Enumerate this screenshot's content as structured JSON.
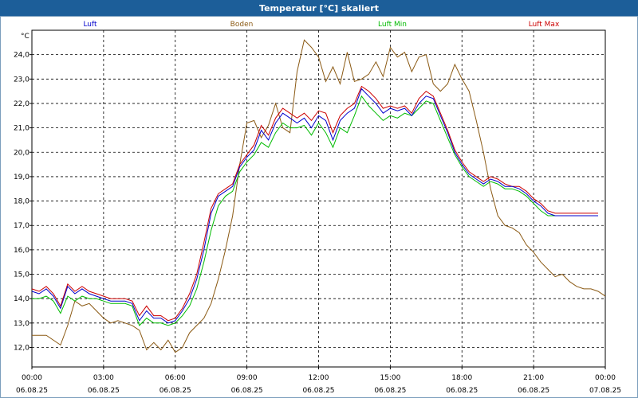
{
  "window": {
    "title": "Temperatur [°C] skaliert"
  },
  "chart_data": {
    "type": "line",
    "title": "Temperatur [°C] skaliert",
    "ylabel": "°C",
    "ylim": [
      11.2,
      25.0
    ],
    "grid": true,
    "x_tick_labels": [
      [
        "00:00",
        "06.08.25"
      ],
      [
        "03:00",
        "06.08.25"
      ],
      [
        "06:00",
        "06.08.25"
      ],
      [
        "09:00",
        "06.08.25"
      ],
      [
        "12:00",
        "06.08.25"
      ],
      [
        "15:00",
        "06.08.25"
      ],
      [
        "18:00",
        "06.08.25"
      ],
      [
        "21:00",
        "06.08.25"
      ],
      [
        "00:00",
        "07.08.25"
      ]
    ],
    "y_ticks": [
      "12,0",
      "13,0",
      "14,0",
      "15,0",
      "16,0",
      "17,0",
      "18,0",
      "19,0",
      "20,0",
      "21,0",
      "22,0",
      "23,0",
      "24,0"
    ],
    "series": [
      {
        "name": "Luft",
        "color": "#0000cc",
        "x": [
          0,
          0.3,
          0.6,
          0.9,
          1.2,
          1.5,
          1.8,
          2.1,
          2.4,
          2.7,
          3,
          3.3,
          3.6,
          3.9,
          4.2,
          4.5,
          4.8,
          5.1,
          5.4,
          5.7,
          6,
          6.3,
          6.6,
          6.9,
          7.2,
          7.5,
          7.8,
          8.1,
          8.4,
          8.7,
          9,
          9.3,
          9.6,
          9.9,
          10.2,
          10.5,
          10.8,
          11.1,
          11.4,
          11.7,
          12,
          12.3,
          12.6,
          12.9,
          13.2,
          13.5,
          13.8,
          14.1,
          14.4,
          14.7,
          15,
          15.3,
          15.6,
          15.9,
          16.2,
          16.5,
          16.8,
          17.1,
          17.4,
          17.7,
          18,
          18.3,
          18.6,
          18.9,
          19.2,
          19.5,
          19.8,
          20.1,
          20.4,
          20.7,
          21,
          21.3,
          21.6,
          21.9,
          22.2,
          22.5,
          22.8,
          23.1,
          23.4,
          23.7
        ],
        "y": [
          14.3,
          14.2,
          14.4,
          14.1,
          13.6,
          14.5,
          14.2,
          14.4,
          14.2,
          14.1,
          14.0,
          13.9,
          13.9,
          13.9,
          13.8,
          13.1,
          13.5,
          13.2,
          13.2,
          13.0,
          13.1,
          13.5,
          14.0,
          14.8,
          16.0,
          17.5,
          18.2,
          18.4,
          18.6,
          19.4,
          19.8,
          20.1,
          20.9,
          20.5,
          21.2,
          21.6,
          21.4,
          21.2,
          21.4,
          21.0,
          21.5,
          21.3,
          20.5,
          21.3,
          21.6,
          21.8,
          22.6,
          22.3,
          22.0,
          21.6,
          21.8,
          21.7,
          21.8,
          21.5,
          22.0,
          22.3,
          22.2,
          21.5,
          20.8,
          20.0,
          19.5,
          19.1,
          18.9,
          18.7,
          18.9,
          18.8,
          18.6,
          18.6,
          18.5,
          18.3,
          18.0,
          17.8,
          17.5,
          17.4,
          17.4,
          17.4,
          17.4,
          17.4,
          17.4,
          17.4
        ]
      },
      {
        "name": "Boden",
        "color": "#8b5a14",
        "x": [
          0,
          0.6,
          1.2,
          1.5,
          1.8,
          2.1,
          2.4,
          2.7,
          3,
          3.3,
          3.6,
          3.9,
          4.2,
          4.5,
          4.8,
          5.1,
          5.4,
          5.7,
          6,
          6.3,
          6.6,
          6.9,
          7.2,
          7.5,
          7.8,
          8.1,
          8.4,
          8.7,
          9,
          9.3,
          9.6,
          9.9,
          10.2,
          10.5,
          10.8,
          11.1,
          11.4,
          11.7,
          12,
          12.3,
          12.6,
          12.9,
          13.2,
          13.5,
          13.8,
          14.1,
          14.4,
          14.7,
          15,
          15.3,
          15.6,
          15.9,
          16.2,
          16.5,
          16.8,
          17.1,
          17.4,
          17.7,
          18,
          18.3,
          18.6,
          18.9,
          19.2,
          19.5,
          19.8,
          20.1,
          20.4,
          20.7,
          21,
          21.3,
          21.6,
          21.9,
          22.2,
          22.5,
          22.8,
          23.1,
          23.4,
          23.7,
          24
        ],
        "y": [
          12.5,
          12.5,
          12.1,
          12.9,
          13.9,
          13.7,
          13.8,
          13.5,
          13.2,
          13.0,
          13.1,
          13.0,
          12.9,
          12.7,
          11.9,
          12.2,
          11.9,
          12.3,
          11.8,
          12.0,
          12.6,
          12.9,
          13.2,
          13.8,
          14.8,
          16.0,
          17.4,
          19.5,
          21.2,
          21.3,
          20.6,
          21.1,
          22.0,
          21.0,
          20.8,
          23.3,
          24.6,
          24.3,
          23.9,
          22.9,
          23.5,
          22.8,
          24.1,
          22.9,
          23.0,
          23.2,
          23.7,
          23.1,
          24.3,
          23.9,
          24.1,
          23.3,
          23.9,
          24.0,
          22.8,
          22.5,
          22.8,
          23.6,
          23.0,
          22.5,
          21.3,
          20.0,
          18.5,
          17.4,
          17.0,
          16.9,
          16.7,
          16.2,
          15.9,
          15.5,
          15.2,
          14.9,
          15.0,
          14.7,
          14.5,
          14.4,
          14.4,
          14.3,
          14.1
        ]
      },
      {
        "name": "Luft Min",
        "color": "#00bb00",
        "x": [
          0,
          0.3,
          0.6,
          0.9,
          1.2,
          1.5,
          1.8,
          2.1,
          2.4,
          2.7,
          3,
          3.3,
          3.6,
          3.9,
          4.2,
          4.5,
          4.8,
          5.1,
          5.4,
          5.7,
          6,
          6.3,
          6.6,
          6.9,
          7.2,
          7.5,
          7.8,
          8.1,
          8.4,
          8.7,
          9,
          9.3,
          9.6,
          9.9,
          10.2,
          10.5,
          10.8,
          11.1,
          11.4,
          11.7,
          12,
          12.3,
          12.6,
          12.9,
          13.2,
          13.5,
          13.8,
          14.1,
          14.4,
          14.7,
          15,
          15.3,
          15.6,
          15.9,
          16.2,
          16.5,
          16.8,
          17.1,
          17.4,
          17.7,
          18,
          18.3,
          18.6,
          18.9,
          19.2,
          19.5,
          19.8,
          20.1,
          20.4,
          20.7,
          21,
          21.3,
          21.6,
          21.9,
          22.2,
          22.5,
          22.8,
          23.1,
          23.4,
          23.7
        ],
        "y": [
          14.0,
          14.0,
          14.1,
          13.9,
          13.4,
          14.1,
          13.9,
          14.1,
          14.0,
          14.0,
          13.9,
          13.8,
          13.8,
          13.8,
          13.7,
          12.9,
          13.2,
          13.0,
          13.0,
          12.9,
          13.0,
          13.3,
          13.7,
          14.4,
          15.5,
          16.8,
          17.8,
          18.2,
          18.4,
          19.2,
          19.6,
          19.9,
          20.4,
          20.2,
          20.8,
          21.2,
          21.0,
          21.0,
          21.1,
          20.7,
          21.2,
          20.8,
          20.2,
          21.0,
          20.8,
          21.5,
          22.3,
          21.9,
          21.6,
          21.3,
          21.5,
          21.4,
          21.6,
          21.5,
          21.8,
          22.1,
          22.0,
          21.3,
          20.6,
          19.9,
          19.4,
          19.0,
          18.8,
          18.6,
          18.8,
          18.7,
          18.5,
          18.5,
          18.4,
          18.2,
          17.9,
          17.6,
          17.4,
          17.4,
          17.4,
          17.4,
          17.4,
          17.4,
          17.4,
          17.4
        ]
      },
      {
        "name": "Luft Max",
        "color": "#cc0000",
        "x": [
          0,
          0.3,
          0.6,
          0.9,
          1.2,
          1.5,
          1.8,
          2.1,
          2.4,
          2.7,
          3,
          3.3,
          3.6,
          3.9,
          4.2,
          4.5,
          4.8,
          5.1,
          5.4,
          5.7,
          6,
          6.3,
          6.6,
          6.9,
          7.2,
          7.5,
          7.8,
          8.1,
          8.4,
          8.7,
          9,
          9.3,
          9.6,
          9.9,
          10.2,
          10.5,
          10.8,
          11.1,
          11.4,
          11.7,
          12,
          12.3,
          12.6,
          12.9,
          13.2,
          13.5,
          13.8,
          14.1,
          14.4,
          14.7,
          15,
          15.3,
          15.6,
          15.9,
          16.2,
          16.5,
          16.8,
          17.1,
          17.4,
          17.7,
          18,
          18.3,
          18.6,
          18.9,
          19.2,
          19.5,
          19.8,
          20.1,
          20.4,
          20.7,
          21,
          21.3,
          21.6,
          21.9,
          22.2,
          22.5,
          22.8,
          23.1,
          23.4,
          23.7
        ],
        "y": [
          14.4,
          14.3,
          14.5,
          14.2,
          13.7,
          14.6,
          14.3,
          14.5,
          14.3,
          14.2,
          14.1,
          14.0,
          14.0,
          14.0,
          13.9,
          13.3,
          13.7,
          13.3,
          13.3,
          13.1,
          13.2,
          13.6,
          14.2,
          15.0,
          16.3,
          17.7,
          18.3,
          18.5,
          18.7,
          19.5,
          19.9,
          20.3,
          21.1,
          20.7,
          21.4,
          21.8,
          21.6,
          21.4,
          21.6,
          21.3,
          21.7,
          21.6,
          20.8,
          21.5,
          21.8,
          22.0,
          22.7,
          22.5,
          22.2,
          21.8,
          21.9,
          21.8,
          21.9,
          21.6,
          22.2,
          22.5,
          22.3,
          21.6,
          20.9,
          20.1,
          19.6,
          19.2,
          19.0,
          18.8,
          19.0,
          18.9,
          18.7,
          18.6,
          18.6,
          18.4,
          18.1,
          17.9,
          17.6,
          17.5,
          17.5,
          17.5,
          17.5,
          17.5,
          17.5,
          17.5
        ]
      }
    ]
  }
}
